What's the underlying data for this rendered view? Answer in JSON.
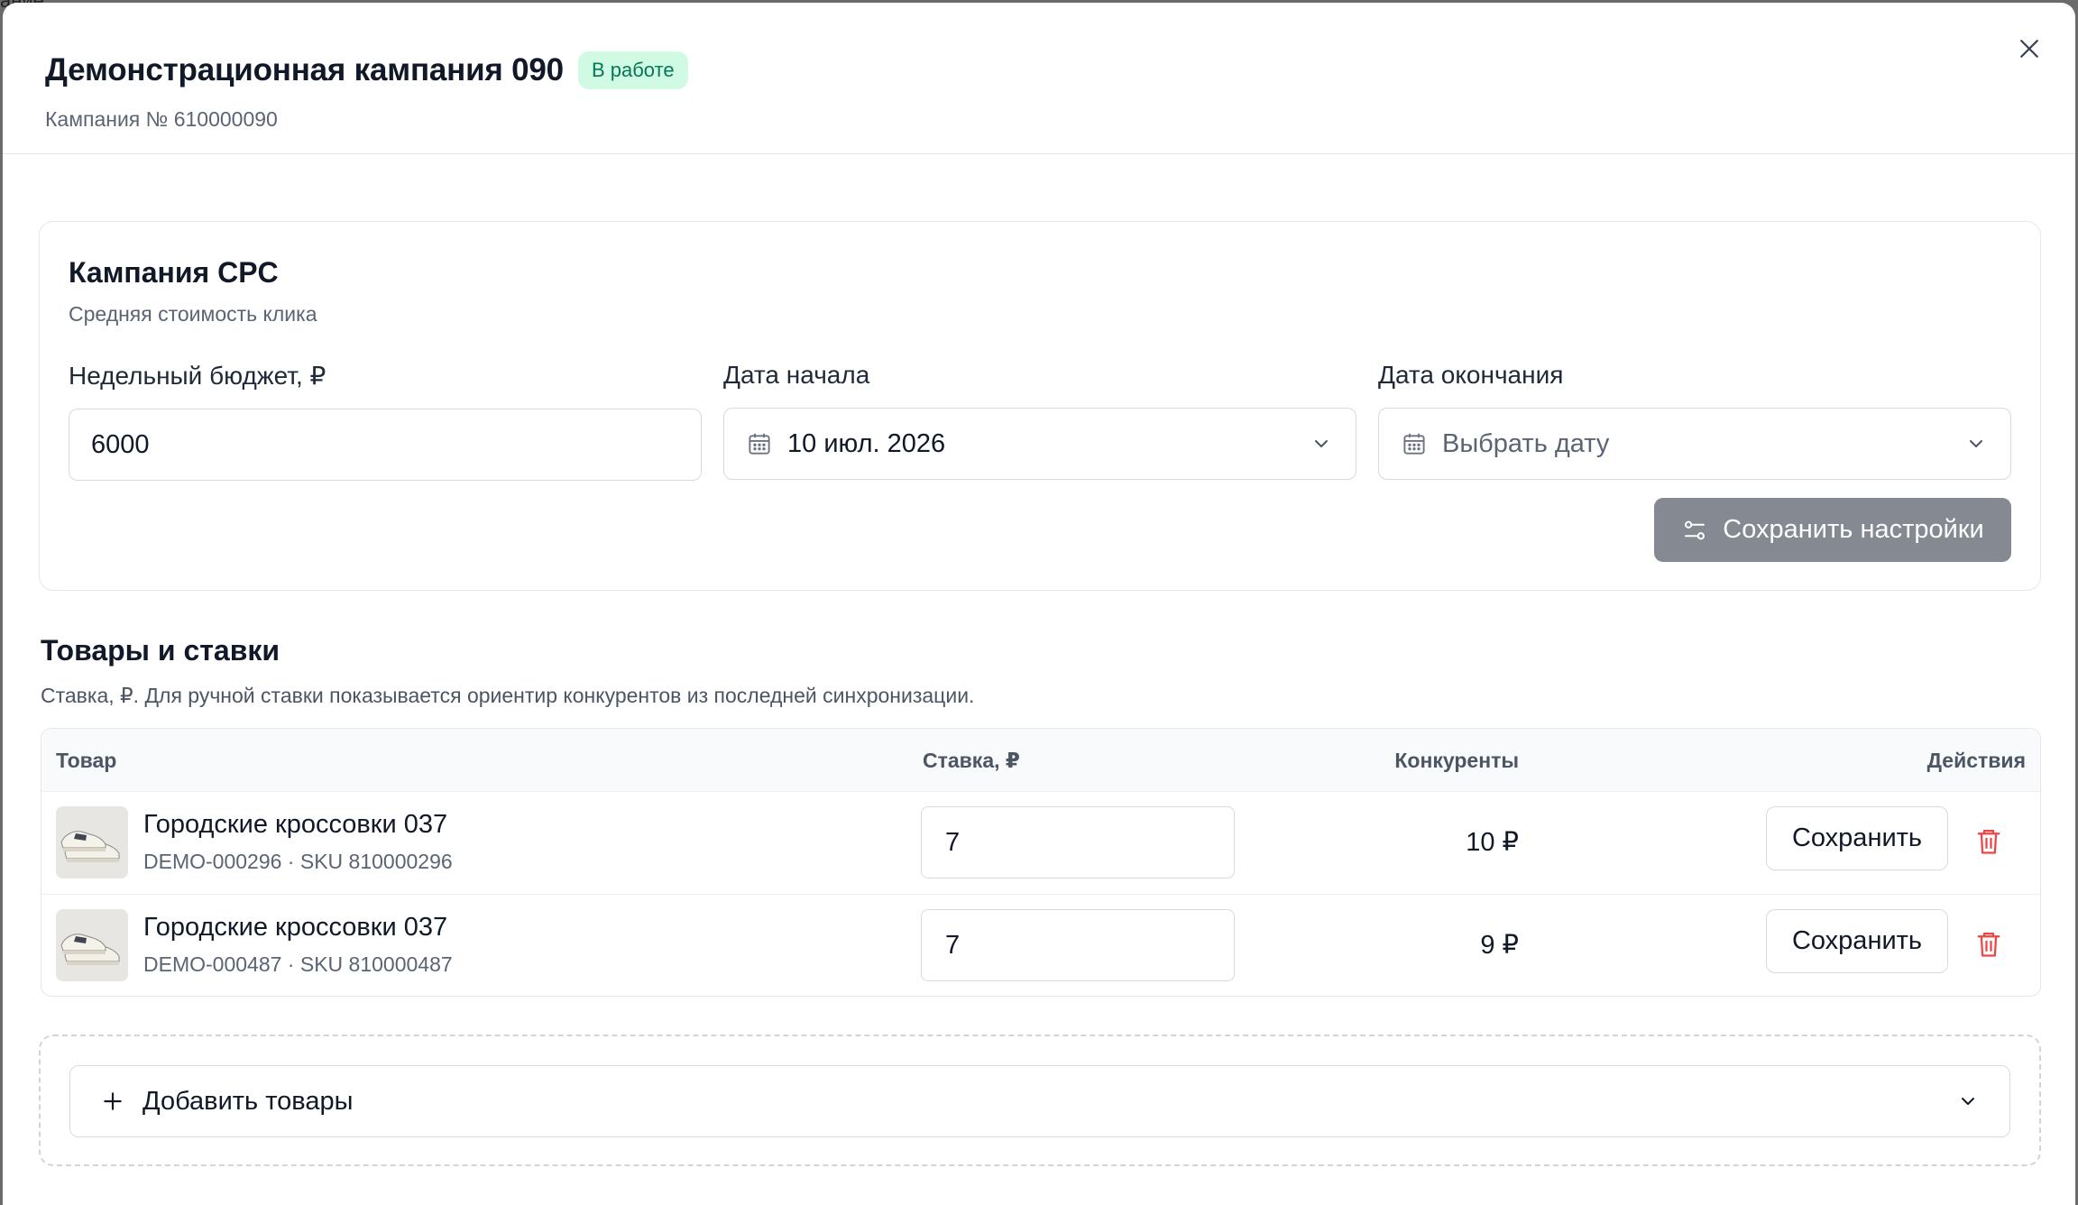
{
  "background": {
    "peek_text": "ание"
  },
  "header": {
    "title": "Демонстрационная кампания 090",
    "status": "В работе",
    "campaign_number": "Кампания № 610000090"
  },
  "settings": {
    "title": "Кампания CPC",
    "subtitle": "Средняя стоимость клика",
    "budget_label": "Недельный бюджет, ₽",
    "budget_value": "6000",
    "start_label": "Дата начала",
    "start_value": "10 июл. 2026",
    "end_label": "Дата окончания",
    "end_placeholder": "Выбрать дату",
    "save_label": "Сохранить настройки"
  },
  "products": {
    "title": "Товары и ставки",
    "subtitle": "Ставка, ₽. Для ручной ставки показывается ориентир конкурентов из последней синхронизации.",
    "columns": {
      "product": "Товар",
      "bid": "Ставка, ₽",
      "competitors": "Конкуренты",
      "actions": "Действия"
    },
    "rows": [
      {
        "name": "Городские кроссовки 037",
        "meta": "DEMO-000296 · SKU 810000296",
        "bid": "7",
        "competitors": "10 ₽",
        "save": "Сохранить"
      },
      {
        "name": "Городские кроссовки 037",
        "meta": "DEMO-000487 · SKU 810000487",
        "bid": "7",
        "competitors": "9 ₽",
        "save": "Сохранить"
      }
    ],
    "add_label": "Добавить товары"
  },
  "colors": {
    "status_bg": "#d1fae5",
    "status_text": "#047857",
    "save_settings_bg": "#858a92",
    "delete_icon": "#ef4444"
  },
  "icons": [
    "close-icon",
    "calendar-icon",
    "chevron-down-icon",
    "sliders-icon",
    "trash-icon",
    "plus-icon"
  ]
}
